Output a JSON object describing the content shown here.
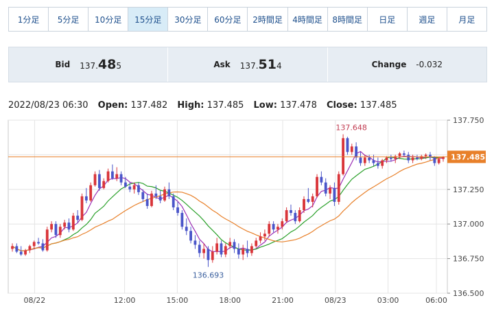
{
  "timeframes": [
    "1分足",
    "5分足",
    "10分足",
    "15分足",
    "30分足",
    "60分足",
    "2時間足",
    "4時間足",
    "8時間足",
    "日足",
    "週足",
    "月足"
  ],
  "active_timeframe": "15分足",
  "quote": {
    "bid_label": "Bid",
    "bid_prefix": "137.",
    "bid_big": "48",
    "bid_suffix": "5",
    "ask_label": "Ask",
    "ask_prefix": "137.",
    "ask_big": "51",
    "ask_suffix": "4",
    "change_label": "Change",
    "change_value": "-0.032"
  },
  "ohlc": {
    "datetime": "2022/08/23 06:30",
    "open_label": "Open:",
    "open": "137.482",
    "high_label": "High:",
    "high": "137.485",
    "low_label": "Low:",
    "low": "137.478",
    "close_label": "Close:",
    "close": "137.485"
  },
  "colors": {
    "up": "#d9353a",
    "down": "#4a55c9",
    "ma_short": "#9b2fb5",
    "ma_mid": "#2aa02a",
    "ma_long": "#e8802a",
    "price_line": "#e8802a"
  },
  "chart_data": {
    "type": "candlestick",
    "ylim": [
      136.5,
      137.75
    ],
    "y_ticks": [
      "137.750",
      "137.500",
      "137.250",
      "137.000",
      "136.750",
      "136.500"
    ],
    "x_ticks": [
      "08/22",
      "12:00",
      "15:00",
      "18:00",
      "21:00",
      "08/23",
      "03:00",
      "06:00"
    ],
    "current_price": "137.485",
    "annotations": {
      "high": "137.648",
      "low": "136.693"
    },
    "candles": [
      [
        136.82,
        136.86,
        136.8,
        136.84
      ],
      [
        136.84,
        136.86,
        136.79,
        136.8
      ],
      [
        136.8,
        136.84,
        136.77,
        136.78
      ],
      [
        136.78,
        136.82,
        136.77,
        136.81
      ],
      [
        136.81,
        136.85,
        136.79,
        136.84
      ],
      [
        136.84,
        136.88,
        136.82,
        136.87
      ],
      [
        136.87,
        136.9,
        136.85,
        136.86
      ],
      [
        136.86,
        136.89,
        136.8,
        136.81
      ],
      [
        136.81,
        136.98,
        136.8,
        136.96
      ],
      [
        136.96,
        137.02,
        136.94,
        137.0
      ],
      [
        137.0,
        137.02,
        136.9,
        136.92
      ],
      [
        136.92,
        137.0,
        136.9,
        136.98
      ],
      [
        136.98,
        137.03,
        136.96,
        137.01
      ],
      [
        137.01,
        137.04,
        136.94,
        136.96
      ],
      [
        136.96,
        137.08,
        136.95,
        137.06
      ],
      [
        137.06,
        137.1,
        137.01,
        137.03
      ],
      [
        137.03,
        137.22,
        137.02,
        137.2
      ],
      [
        137.2,
        137.26,
        137.15,
        137.17
      ],
      [
        137.17,
        137.3,
        137.16,
        137.28
      ],
      [
        137.28,
        137.38,
        137.27,
        137.36
      ],
      [
        137.36,
        137.39,
        137.24,
        137.26
      ],
      [
        137.26,
        137.33,
        137.25,
        137.31
      ],
      [
        137.31,
        137.4,
        137.3,
        137.38
      ],
      [
        137.38,
        137.43,
        137.32,
        137.33
      ],
      [
        137.33,
        137.41,
        137.31,
        137.36
      ],
      [
        137.36,
        137.38,
        137.28,
        137.3
      ],
      [
        137.3,
        137.34,
        137.26,
        137.27
      ],
      [
        137.27,
        137.3,
        137.23,
        137.25
      ],
      [
        137.25,
        137.3,
        137.22,
        137.28
      ],
      [
        137.28,
        137.3,
        137.21,
        137.23
      ],
      [
        137.23,
        137.25,
        137.16,
        137.18
      ],
      [
        137.18,
        137.22,
        137.11,
        137.13
      ],
      [
        137.13,
        137.24,
        137.12,
        137.22
      ],
      [
        137.22,
        137.28,
        137.18,
        137.2
      ],
      [
        137.2,
        137.24,
        137.15,
        137.17
      ],
      [
        137.17,
        137.27,
        137.16,
        137.25
      ],
      [
        137.25,
        137.3,
        137.18,
        137.2
      ],
      [
        137.2,
        137.22,
        137.1,
        137.12
      ],
      [
        137.12,
        137.16,
        137.06,
        137.08
      ],
      [
        137.08,
        137.1,
        136.96,
        136.98
      ],
      [
        136.98,
        137.04,
        136.92,
        136.95
      ],
      [
        136.95,
        136.98,
        136.86,
        136.88
      ],
      [
        136.88,
        136.92,
        136.82,
        136.85
      ],
      [
        136.85,
        136.88,
        136.76,
        136.79
      ],
      [
        136.79,
        136.86,
        136.75,
        136.82
      ],
      [
        136.82,
        136.84,
        136.69,
        136.74
      ],
      [
        136.74,
        136.84,
        136.72,
        136.8
      ],
      [
        136.8,
        136.9,
        136.78,
        136.86
      ],
      [
        136.86,
        136.88,
        136.76,
        136.78
      ],
      [
        136.78,
        136.86,
        136.76,
        136.84
      ],
      [
        136.84,
        136.9,
        136.82,
        136.87
      ],
      [
        136.87,
        136.89,
        136.79,
        136.82
      ],
      [
        136.82,
        136.86,
        136.75,
        136.78
      ],
      [
        136.78,
        136.85,
        136.74,
        136.82
      ],
      [
        136.82,
        136.88,
        136.76,
        136.79
      ],
      [
        136.79,
        136.86,
        136.77,
        136.84
      ],
      [
        136.84,
        136.9,
        136.83,
        136.88
      ],
      [
        136.88,
        136.94,
        136.86,
        136.91
      ],
      [
        136.91,
        136.96,
        136.88,
        136.93
      ],
      [
        136.93,
        137.02,
        136.91,
        137.0
      ],
      [
        137.0,
        137.02,
        136.94,
        136.96
      ],
      [
        136.96,
        137.0,
        136.93,
        136.98
      ],
      [
        136.98,
        137.04,
        136.96,
        137.02
      ],
      [
        137.02,
        137.12,
        137.01,
        137.1
      ],
      [
        137.1,
        137.14,
        137.06,
        137.08
      ],
      [
        137.08,
        137.1,
        137.0,
        137.02
      ],
      [
        137.02,
        137.12,
        137.01,
        137.1
      ],
      [
        137.1,
        137.2,
        137.08,
        137.18
      ],
      [
        137.18,
        137.26,
        137.15,
        137.16
      ],
      [
        137.16,
        137.22,
        137.12,
        137.2
      ],
      [
        137.2,
        137.36,
        137.19,
        137.34
      ],
      [
        137.34,
        137.38,
        137.28,
        137.3
      ],
      [
        137.3,
        137.33,
        137.2,
        137.22
      ],
      [
        137.22,
        137.28,
        137.18,
        137.26
      ],
      [
        137.26,
        137.3,
        137.13,
        137.16
      ],
      [
        137.16,
        137.38,
        137.14,
        137.36
      ],
      [
        137.36,
        137.648,
        137.35,
        137.62
      ],
      [
        137.62,
        137.63,
        137.5,
        137.52
      ],
      [
        137.52,
        137.58,
        137.5,
        137.56
      ],
      [
        137.56,
        137.59,
        137.46,
        137.48
      ],
      [
        137.48,
        137.52,
        137.42,
        137.44
      ],
      [
        137.44,
        137.5,
        137.42,
        137.48
      ],
      [
        137.48,
        137.5,
        137.44,
        137.46
      ],
      [
        137.46,
        137.5,
        137.42,
        137.44
      ],
      [
        137.44,
        137.48,
        137.4,
        137.42
      ],
      [
        137.42,
        137.47,
        137.4,
        137.46
      ],
      [
        137.46,
        137.49,
        137.44,
        137.48
      ],
      [
        137.48,
        137.5,
        137.45,
        137.47
      ],
      [
        137.47,
        137.5,
        137.44,
        137.49
      ],
      [
        137.49,
        137.52,
        137.47,
        137.51
      ],
      [
        137.51,
        137.53,
        137.49,
        137.5
      ],
      [
        137.5,
        137.52,
        137.44,
        137.46
      ],
      [
        137.46,
        137.5,
        137.44,
        137.48
      ],
      [
        137.48,
        137.5,
        137.46,
        137.47
      ],
      [
        137.47,
        137.5,
        137.46,
        137.49
      ],
      [
        137.49,
        137.51,
        137.47,
        137.5
      ],
      [
        137.5,
        137.52,
        137.46,
        137.48
      ],
      [
        137.48,
        137.49,
        137.42,
        137.44
      ],
      [
        137.44,
        137.48,
        137.43,
        137.47
      ],
      [
        137.47,
        137.49,
        137.45,
        137.485
      ]
    ]
  }
}
